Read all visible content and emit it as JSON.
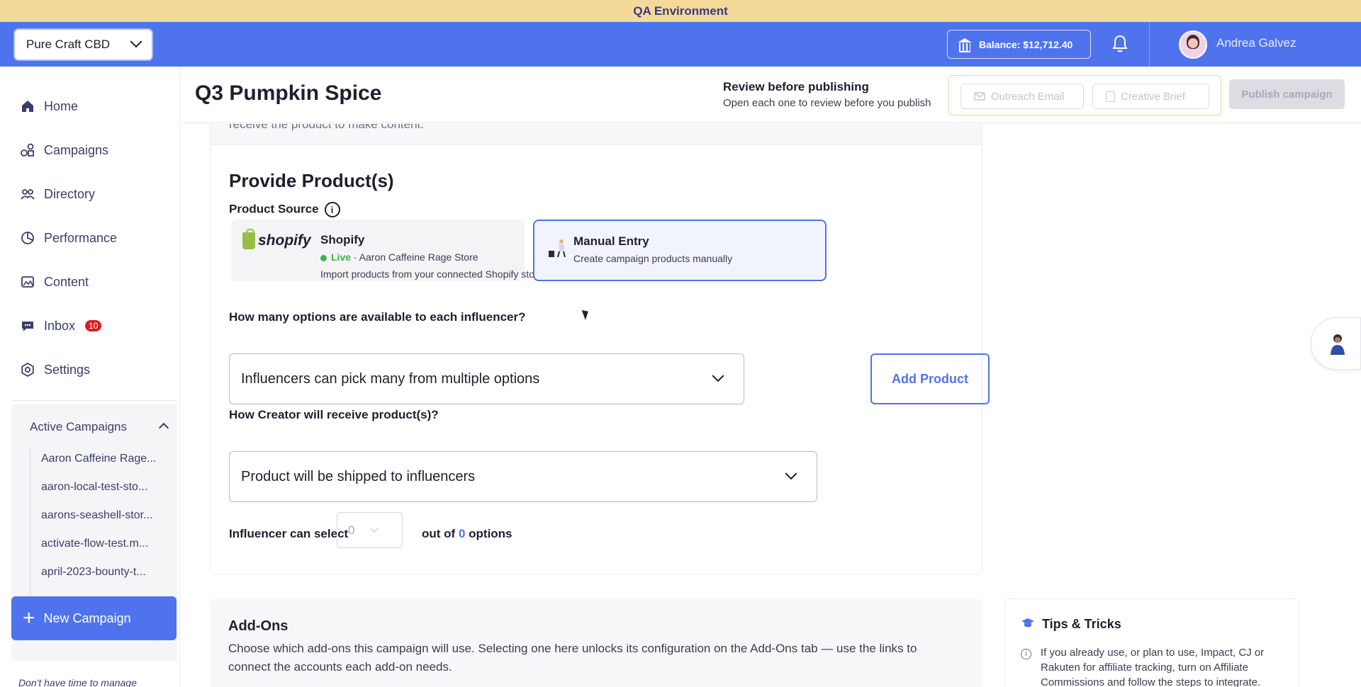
{
  "banner": {
    "text": "QA Environment"
  },
  "topbar": {
    "store": "Pure Craft CBD",
    "balance": "Balance: $12,712.40",
    "user_name": "Andrea Galvez"
  },
  "sidebar": {
    "items": [
      {
        "label": "Home",
        "icon": "home-icon"
      },
      {
        "label": "Campaigns",
        "icon": "campaigns-icon"
      },
      {
        "label": "Directory",
        "icon": "directory-icon"
      },
      {
        "label": "Performance",
        "icon": "performance-icon"
      },
      {
        "label": "Content",
        "icon": "content-icon"
      },
      {
        "label": "Inbox",
        "icon": "inbox-icon",
        "badge": "10"
      },
      {
        "label": "Settings",
        "icon": "settings-icon"
      }
    ],
    "active_campaigns": {
      "title": "Active Campaigns",
      "items": [
        "Aaron Caffeine Rage...",
        "aaron-local-test-sto...",
        "aarons-seashell-stor...",
        "activate-flow-test.m...",
        "april-2023-bounty-t..."
      ]
    },
    "new_campaign": "New Campaign",
    "footer_text": "Don't have time to manage"
  },
  "header": {
    "title": "Q3 Pumpkin Spice",
    "review_title": "Review before publishing",
    "review_sub": "Open each one to review before you publish",
    "outreach_email": "Outreach Email",
    "creative_brief": "Creative Brief",
    "publish": "Publish campaign"
  },
  "main": {
    "prev_tail": "receive the product to make content.",
    "section_title": "Provide Product(s)",
    "product_source_label": "Product Source",
    "shopify": {
      "logo_text": "shopify",
      "name": "Shopify",
      "status": "Live",
      "store": "· Aaron Caffeine Rage Store",
      "desc": "Import products from your connected Shopify store"
    },
    "manual": {
      "name": "Manual Entry",
      "desc": "Create campaign products manually"
    },
    "options_question": "How many options are available to each influencer?",
    "options_value": "Influencers can pick many from multiple options",
    "add_product": "Add Product",
    "receive_question": "How Creator will receive product(s)?",
    "receive_value": "Product will be shipped to influencers",
    "select_prefix": "Influencer can select",
    "select_value": "0",
    "select_mid": "out of",
    "select_total": "0",
    "select_suffix": "options"
  },
  "addons": {
    "title": "Add-Ons",
    "text": "Choose which add-ons this campaign will use. Selecting one here unlocks its configuration on the Add-Ons tab — use the links to connect the accounts each add-on needs."
  },
  "tips": {
    "title": "Tips & Tricks",
    "text": "If you already use, or plan to use, Impact, CJ or Rakuten for affiliate tracking, turn on Affiliate Commissions and follow the steps to integrate."
  },
  "colors": {
    "brand": "#4f73ec",
    "banner": "#f4d99a",
    "live": "#3bb34a",
    "badge": "#d21f26"
  }
}
